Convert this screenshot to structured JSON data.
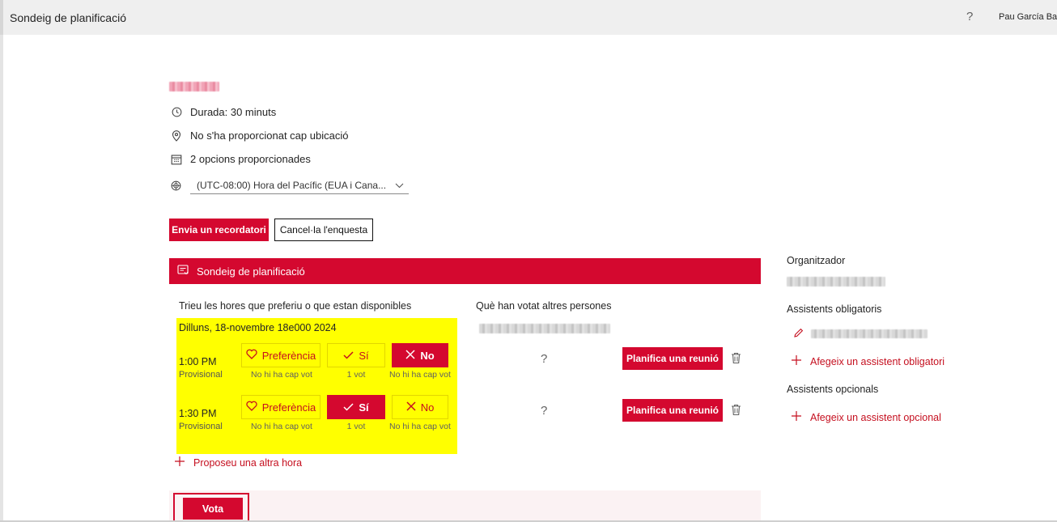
{
  "header": {
    "title": "Sondeig de planificació",
    "help_icon": "?",
    "user_name": "Pau García Batl"
  },
  "poll": {
    "duration": "Durada: 30 minuts",
    "location": "No s'ha proporcionat cap ubicació",
    "options_count": "2 opcions proporcionades",
    "timezone": "(UTC-08:00) Hora del Pacífic (EUA i Cana..."
  },
  "actions": {
    "reminder": "Envia un recordatori",
    "cancel": "Cancel·la l'enquesta"
  },
  "section_title": "Sondeig de planificació",
  "choose_title": "Trieu les hores que preferiu o que estan disponibles",
  "others_title": "Què han votat altres persones",
  "date": "Dilluns, 18-novembre 18e000 2024",
  "slots": [
    {
      "time": "1:00 PM",
      "status": "Provisional",
      "options": [
        {
          "label": "Preferència",
          "icon": "heart-icon",
          "count": "No hi ha cap vot",
          "selected": false
        },
        {
          "label": "Sí",
          "icon": "check-icon",
          "count": "1 vot",
          "selected": false
        },
        {
          "label": "No",
          "icon": "close-icon",
          "count": "No hi ha cap vot",
          "selected": true
        }
      ],
      "other_vote": "?",
      "schedule": "Planifica una reunió"
    },
    {
      "time": "1:30 PM",
      "status": "Provisional",
      "options": [
        {
          "label": "Preferència",
          "icon": "heart-icon",
          "count": "No hi ha cap vot",
          "selected": false
        },
        {
          "label": "Sí",
          "icon": "check-icon",
          "count": "1 vot",
          "selected": true
        },
        {
          "label": "No",
          "icon": "close-icon",
          "count": "No hi ha cap vot",
          "selected": false
        }
      ],
      "other_vote": "?",
      "schedule": "Planifica una reunió"
    }
  ],
  "propose": "Proposeu una altra hora",
  "vote_button": "Vota",
  "sidebar": {
    "organizer_label": "Organitzador",
    "required_label": "Assistents obligatoris",
    "add_required": "Afegeix un assistent obligatori",
    "optional_label": "Assistents opcionals",
    "add_optional": "Afegeix un assistent opcional"
  },
  "colors": {
    "accent": "#d4082f",
    "highlight": "#ffff00"
  }
}
